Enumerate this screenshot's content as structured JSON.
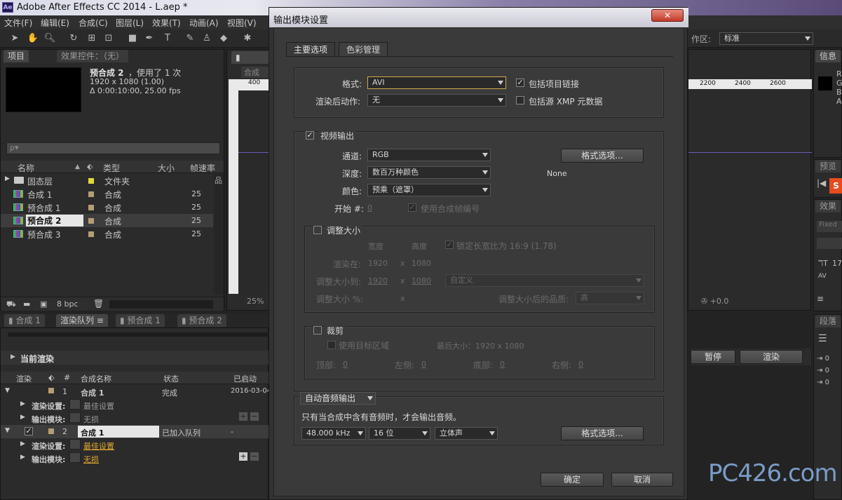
{
  "window": {
    "title": "Adobe After Effects CC 2014 - L.aep *",
    "app_icon": "Ae"
  },
  "menu": [
    "文件(F)",
    "编辑(E)",
    "合成(C)",
    "图层(L)",
    "效果(T)",
    "动画(A)",
    "视图(V)"
  ],
  "toolbar": {
    "workspace_label": "作区:",
    "workspace_value": "标准"
  },
  "project_panel": {
    "tab_project": "项目",
    "tab_effects": "效果控件：（无）",
    "selected_name": "预合成 2",
    "selected_usage": "，使用了 1 次",
    "selected_size": "1920 x 1080 (1.00)",
    "selected_duration": "Δ 0:00:10:00, 25.00 fps",
    "search_placeholder": "ρ▾",
    "columns": [
      "名称",
      "类型",
      "大小",
      "帧速率"
    ],
    "rows": [
      {
        "name": "固态层",
        "type": "文件夹",
        "size": "",
        "fps": "",
        "kind": "folder",
        "color": "#e4d93a"
      },
      {
        "name": "合成 1",
        "type": "合成",
        "size": "",
        "fps": "25",
        "kind": "comp",
        "color": "#b79d74"
      },
      {
        "name": "预合成 1",
        "type": "合成",
        "size": "",
        "fps": "25",
        "kind": "comp",
        "color": "#b79d74"
      },
      {
        "name": "预合成 2",
        "type": "合成",
        "size": "",
        "fps": "25",
        "kind": "comp",
        "color": "#b79d74",
        "selected": true
      },
      {
        "name": "预合成 3",
        "type": "合成",
        "size": "",
        "fps": "25",
        "kind": "comp",
        "color": "#b79d74"
      }
    ],
    "bpc": "8 bpc"
  },
  "comp_panel": {
    "tab": "合成",
    "ruler_start": "400",
    "zoom": "25%"
  },
  "right_panel": {
    "info_tab": "信息",
    "info_letters": [
      "R",
      "G",
      "B",
      "A"
    ],
    "ruler_labels": [
      "2200",
      "2400",
      "2600"
    ],
    "preview_tab": "预览",
    "effects_tab": "效果",
    "char_tab": "段落",
    "fixed_label": "Fixed",
    "char_vals": [
      "17",
      "0 "
    ],
    "offset": "+0.0"
  },
  "bottom_tabs": [
    "合成 1",
    "渲染队列",
    "预合成 1",
    "预合成 2"
  ],
  "render_queue": {
    "current_render": "当前渲染",
    "pause": "暂停",
    "render": "渲染",
    "columns": [
      "渲染",
      "#",
      "合成名称",
      "状态",
      "已启动"
    ],
    "items": [
      {
        "num": "1",
        "name": "合成 1",
        "status": "完成",
        "started": "2016-03-04,",
        "render_settings_label": "渲染设置:",
        "render_settings": "最佳设置",
        "output_label": "输出模块:",
        "output": "无损"
      },
      {
        "num": "2",
        "name": "合成 1",
        "status": "已加入队列",
        "started": "-",
        "render_settings_label": "渲染设置:",
        "render_settings": "最佳设置",
        "output_label": "输出模块:",
        "output": "无损"
      }
    ]
  },
  "dialog": {
    "title": "输出模块设置",
    "close": "✕",
    "tabs": [
      "主要选项",
      "色彩管理"
    ],
    "format_label": "格式:",
    "format_value": "AVI",
    "post_render_label": "渲染后动作:",
    "post_render_value": "无",
    "include_project_link": "包括项目链接",
    "include_xmp": "包括源 XMP 元数据",
    "video_output": "视频输出",
    "channels_label": "通道:",
    "channels_value": "RGB",
    "depth_label": "深度:",
    "depth_value": "数百万种颜色",
    "color_label": "颜色:",
    "color_value": "预乘（遮罩）",
    "start_label": "开始 #:",
    "start_value": "0",
    "use_comp_frame": "使用合成帧编号",
    "format_options": "格式选项...",
    "codec_value": "None",
    "resize": "调整大小",
    "width_label": "宽度",
    "height_label": "高度",
    "lock_aspect": "锁定长宽比为 16:9 (1.78)",
    "render_at_label": "渲染在:",
    "render_at_w": "1920",
    "render_at_h": "1080",
    "resize_to_label": "调整大小到:",
    "resize_to_w": "1920",
    "resize_to_h": "1080",
    "custom": "自定义",
    "resize_pct_label": "调整大小 %:",
    "x_sep": "x",
    "quality_label": "调整大小后的品质:",
    "quality_value": "高",
    "crop": "裁剪",
    "use_roi": "使用目标区域",
    "final_size": "最后大小：1920 x 1080",
    "top_label": "顶部:",
    "top_value": "0",
    "left_label": "左侧:",
    "left_value": "0",
    "bottom_label": "底部:",
    "bottom_value": "0",
    "right_label": "右侧:",
    "right_value": "0",
    "audio_dropdown": "自动音频输出",
    "audio_note": "只有当合成中含有音频时，才会输出音频。",
    "sample_rate": "48.000 kHz",
    "bit_depth": "16 位",
    "channels_audio": "立体声",
    "ok": "确定",
    "cancel": "取消"
  },
  "watermark": "PC426.com"
}
